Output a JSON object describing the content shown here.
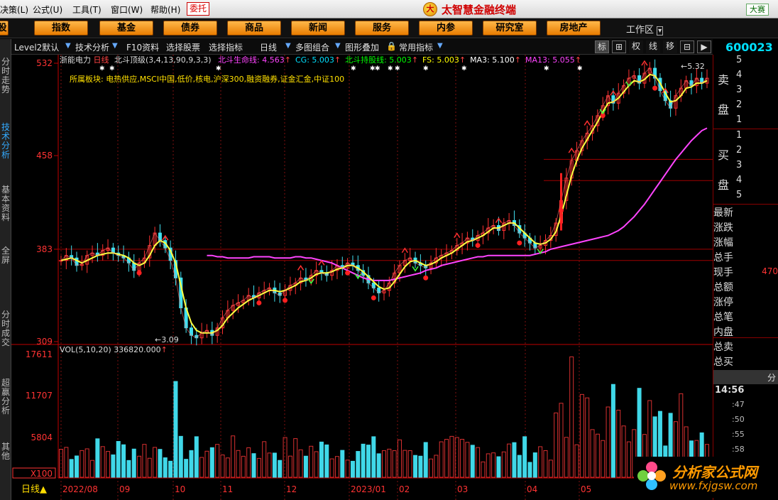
{
  "menu": {
    "items": [
      "决策(L)",
      "公式(U)",
      "工具(T)",
      "窗口(W)",
      "帮助(H)"
    ],
    "weituo": "委托",
    "brand": "太智慧金融终端",
    "dasai": "大赛"
  },
  "nav": {
    "buttons": [
      "股",
      "指数",
      "基金",
      "债券",
      "商品",
      "新闻",
      "服务",
      "内参",
      "研究室",
      "房地产"
    ],
    "workarea": "工作区"
  },
  "toolbar": {
    "items": [
      "Level2默认",
      "技术分析",
      "F10资料",
      "选择股票",
      "选择指标",
      "日线",
      "多图组合",
      "图形叠加",
      "常用指标"
    ],
    "right_icons": [
      "标",
      "⊞",
      "权",
      "线",
      "移",
      "⊟",
      "▶"
    ],
    "code": "600023"
  },
  "left_tabs": [
    "分时走势",
    "技术分析",
    "基本资料",
    "全屏",
    "分时成交",
    "超赢分析",
    "其他"
  ],
  "chart_data": [
    {
      "type": "candlestick",
      "title_line": {
        "stock": "浙能电力",
        "period": "日线",
        "indicator": "北斗顶级(3,4,13,90,9,3,3)",
        "params": [
          {
            "text": "北斗生命线: 4.563",
            "color": "#ff44ff"
          },
          {
            "text": "CG: 5.003",
            "color": "#00e0ff"
          },
          {
            "text": "北斗持股线: 5.003",
            "color": "#00ff00"
          },
          {
            "text": "FS: 5.003",
            "color": "#ffff00"
          },
          {
            "text": "MA3: 5.100",
            "color": "#ffffff"
          },
          {
            "text": "MA13: 5.055",
            "color": "#ff44ff"
          }
        ]
      },
      "sector_line": "所属板块:  电热供应,MSCI中国,低价,核电,沪深300,融资融券,证金汇金,中证100",
      "y_ticks": [
        "532",
        "458",
        "383",
        "309"
      ],
      "annotations": {
        "high": "5.32",
        "low": "3.09"
      },
      "x_labels": [
        "2022/08",
        "09",
        "10",
        "11",
        "12",
        "2023/01",
        "02",
        "03",
        "04",
        "05"
      ],
      "series": [
        {
          "name": "close",
          "values": [
            3.74,
            3.78,
            3.76,
            3.7,
            3.71,
            3.78,
            3.8,
            3.78,
            3.82,
            3.84,
            3.8,
            3.78,
            3.76,
            3.72,
            3.66,
            3.72,
            3.76,
            3.86,
            3.96,
            3.9,
            3.84,
            3.74,
            3.6,
            3.36,
            3.2,
            3.14,
            3.12,
            3.16,
            3.18,
            3.14,
            3.2,
            3.28,
            3.34,
            3.38,
            3.4,
            3.42,
            3.46,
            3.44,
            3.48,
            3.5,
            3.52,
            3.48,
            3.46,
            3.5,
            3.54,
            3.56,
            3.6,
            3.58,
            3.62,
            3.66,
            3.64,
            3.62,
            3.66,
            3.7,
            3.68,
            3.72,
            3.7,
            3.66,
            3.62,
            3.56,
            3.52,
            3.48,
            3.5,
            3.56,
            3.64,
            3.7,
            3.74,
            3.76,
            3.72,
            3.7,
            3.68,
            3.72,
            3.76,
            3.78,
            3.8,
            3.82,
            3.86,
            3.88,
            3.92,
            3.9,
            3.94,
            3.96,
            4.0,
            4.02,
            3.98,
            4.04,
            4.06,
            4.02,
            3.96,
            3.92,
            3.88,
            3.84,
            3.86,
            3.9,
            3.94,
            4.04,
            4.22,
            4.4,
            4.54,
            4.62,
            4.7,
            4.76,
            4.82,
            4.9,
            4.98,
            5.06,
            5.0,
            5.08,
            5.14,
            5.2,
            5.22,
            5.16,
            5.24,
            5.28,
            5.2,
            5.1,
            5.02,
            4.96,
            5.06,
            5.12,
            5.18,
            5.14,
            5.2,
            5.16,
            5.2
          ]
        },
        {
          "name": "MA13",
          "values": [
            3.78,
            3.78,
            3.77,
            3.77,
            3.76,
            3.76,
            3.76,
            3.76,
            3.76,
            3.77,
            3.77,
            3.77,
            3.77,
            3.76,
            3.76,
            3.76,
            3.76,
            3.77,
            3.77,
            3.76,
            3.76,
            3.75,
            3.74,
            3.73,
            3.72,
            3.7,
            3.68,
            3.66,
            3.64,
            3.62,
            3.6,
            3.59,
            3.58,
            3.58,
            3.58,
            3.58,
            3.59,
            3.6,
            3.61,
            3.62,
            3.63,
            3.64,
            3.66,
            3.67,
            3.68,
            3.7,
            3.71,
            3.72,
            3.73,
            3.74,
            3.75,
            3.76,
            3.77,
            3.77,
            3.78,
            3.78,
            3.78,
            3.78,
            3.78,
            3.78,
            3.78,
            3.78,
            3.78,
            3.79,
            3.8,
            3.81,
            3.83,
            3.84,
            3.85,
            3.86,
            3.87,
            3.88,
            3.89,
            3.9,
            3.91,
            3.92,
            3.93,
            3.94,
            3.96,
            3.98,
            4.01,
            4.05,
            4.09,
            4.14,
            4.19,
            4.25,
            4.31,
            4.37,
            4.43,
            4.49,
            4.55,
            4.6,
            4.65,
            4.7,
            4.74,
            4.78,
            4.8
          ]
        },
        {
          "name": "FS",
          "values": [
            3.74,
            3.75,
            3.76,
            3.74,
            3.72,
            3.74,
            3.76,
            3.78,
            3.79,
            3.8,
            3.8,
            3.79,
            3.78,
            3.76,
            3.72,
            3.7,
            3.72,
            3.78,
            3.86,
            3.9,
            3.88,
            3.82,
            3.72,
            3.54,
            3.36,
            3.24,
            3.18,
            3.16,
            3.16,
            3.16,
            3.18,
            3.22,
            3.28,
            3.32,
            3.36,
            3.39,
            3.42,
            3.44,
            3.46,
            3.48,
            3.5,
            3.5,
            3.49,
            3.5,
            3.52,
            3.54,
            3.57,
            3.58,
            3.6,
            3.63,
            3.64,
            3.64,
            3.65,
            3.67,
            3.68,
            3.7,
            3.7,
            3.68,
            3.65,
            3.61,
            3.57,
            3.53,
            3.51,
            3.52,
            3.57,
            3.63,
            3.69,
            3.73,
            3.74,
            3.72,
            3.7,
            3.71,
            3.73,
            3.76,
            3.78,
            3.8,
            3.83,
            3.86,
            3.89,
            3.9,
            3.92,
            3.94,
            3.97,
            4.0,
            4.0,
            4.02,
            4.04,
            4.04,
            4.0,
            3.96,
            3.92,
            3.88,
            3.87,
            3.88,
            3.91,
            3.97,
            4.1,
            4.26,
            4.42,
            4.54,
            4.64,
            4.71,
            4.78,
            4.85,
            4.93,
            5.0,
            5.01,
            5.04,
            5.09,
            5.14,
            5.18,
            5.17,
            5.19,
            5.23,
            5.22,
            5.16,
            5.08,
            5.01,
            5.02,
            5.06,
            5.12,
            5.13,
            5.16,
            5.16,
            5.18
          ]
        }
      ]
    },
    {
      "type": "bar",
      "label": "VOL(5,10,20)",
      "value": "336820.000",
      "y_ticks": [
        "17611",
        "11707",
        "5804",
        "X100"
      ],
      "up_color": "#d83030",
      "down_color": "#40d8e8"
    }
  ],
  "right_panel": {
    "sell_label": [
      "卖",
      "盘"
    ],
    "buy_label": [
      "买",
      "盘"
    ],
    "sell_levels": [
      "5",
      "4",
      "3",
      "2",
      "1"
    ],
    "buy_levels": [
      "1",
      "2",
      "3",
      "4",
      "5"
    ],
    "fields": [
      "最新",
      "涨跌",
      "涨幅",
      "总手",
      "现手",
      "总额",
      "涨停",
      "总笔",
      "内盘",
      "总卖",
      "总买"
    ],
    "xianshou_val": "470",
    "fen_label": "分",
    "time": "14:56",
    "ticks": [
      ":47",
      ":50",
      ":55",
      ":58"
    ]
  },
  "watermark": {
    "text1": "分析家公式网",
    "text2": "www.fxjgsw.com"
  },
  "bottom_left": "日线▲"
}
